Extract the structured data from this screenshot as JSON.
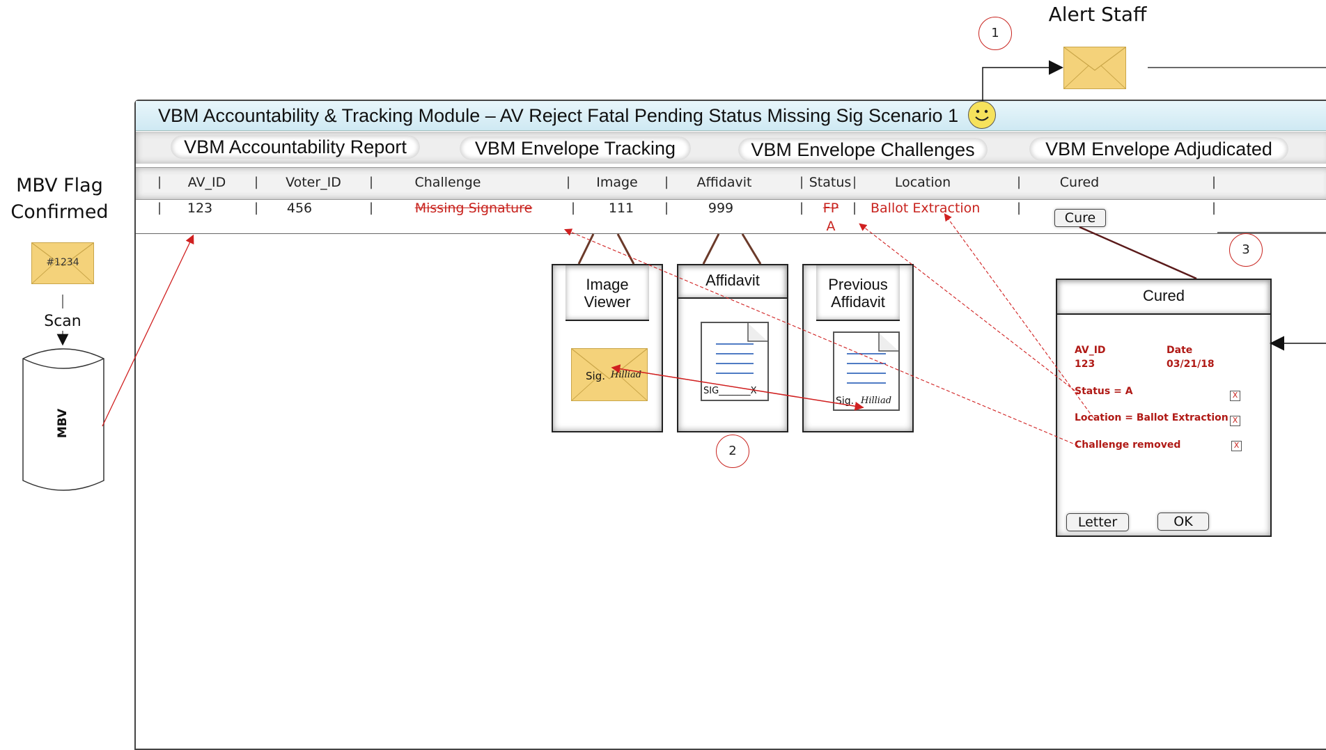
{
  "left": {
    "flag_title": "MBV Flag Confirmed",
    "envelope_id": "#1234",
    "scan_label": "Scan",
    "db_label": "MBV"
  },
  "alert": {
    "label": "Alert Staff",
    "step": "1"
  },
  "module": {
    "title": "VBM Accountability & Tracking Module – AV Reject Fatal Pending Status Missing Sig Scenario 1",
    "tabs": [
      "VBM Accountability Report",
      "VBM Envelope Tracking",
      "VBM Envelope Challenges",
      "VBM Envelope Adjudicated"
    ]
  },
  "table": {
    "headers": [
      "AV_ID",
      "Voter_ID",
      "Challenge",
      "Image",
      "Affidavit",
      "Status",
      "Location",
      "Cured"
    ],
    "row": {
      "av_id": "123",
      "voter_id": "456",
      "challenge": "Missing Signature",
      "image": "111",
      "affidavit": "999",
      "status_old": "FP",
      "status_new": "A",
      "location": "Ballot Extraction",
      "cure_button": "Cure"
    }
  },
  "panels": {
    "image_viewer": "Image Viewer",
    "affidavit": "Affidavit",
    "previous_affidavit": "Previous Affidavit",
    "sig_text": "Sig.",
    "sig_line": "SIG_______X",
    "signature": "Hilliad",
    "step": "2"
  },
  "cured_dialog": {
    "title": "Cured",
    "av_id_label": "AV_ID",
    "av_id_value": "123",
    "date_label": "Date",
    "date_value": "03/21/18",
    "checks": [
      "Status = A",
      "Location = Ballot Extraction",
      "Challenge removed"
    ],
    "check_mark": "X",
    "letter_button": "Letter",
    "ok_button": "OK",
    "step": "3"
  },
  "colors": {
    "accent_red": "#c8231e",
    "envelope": "#f4d27a",
    "title_bar": "#d9eef6"
  }
}
